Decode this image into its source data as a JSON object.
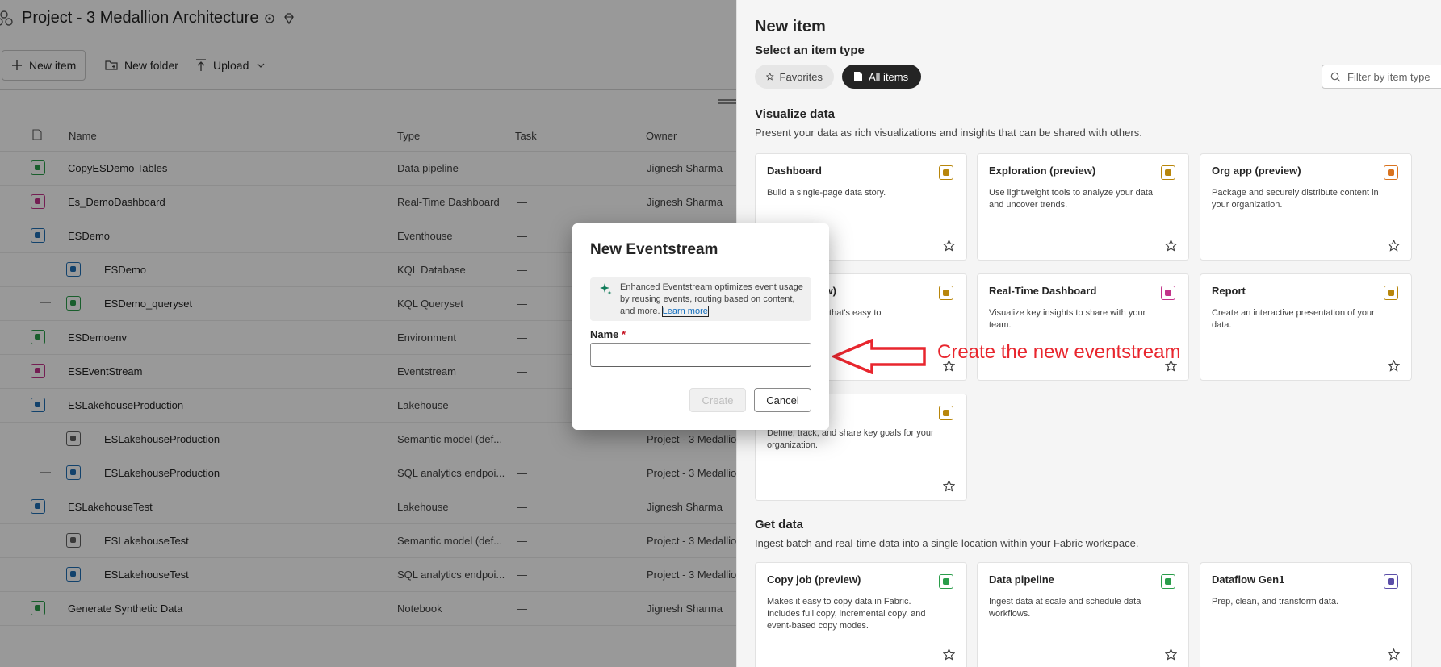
{
  "workspace": {
    "title": "Project - 3 Medallion Architecture",
    "toolbar": {
      "new_item": "New item",
      "new_folder": "New folder",
      "upload": "Upload"
    },
    "columns": {
      "name": "Name",
      "type": "Type",
      "task": "Task",
      "owner": "Owner"
    },
    "rows": [
      {
        "name": "CopyESDemo Tables",
        "type": "Data pipeline",
        "task": "—",
        "owner": "Jignesh Sharma",
        "icon": "data-pipeline-icon",
        "color": "#2a9d4a"
      },
      {
        "name": "Es_DemoDashboard",
        "type": "Real-Time Dashboard",
        "task": "—",
        "owner": "Jignesh Sharma",
        "icon": "dashboard-icon",
        "color": "#c2338a"
      },
      {
        "name": "ESDemo",
        "type": "Eventhouse",
        "task": "—",
        "owner": "",
        "icon": "eventhouse-icon",
        "color": "#1f6fb5"
      },
      {
        "name": "ESDemo",
        "type": "KQL Database",
        "task": "—",
        "owner": "",
        "icon": "kql-database-icon",
        "color": "#1f6fb5"
      },
      {
        "name": "ESDemo_queryset",
        "type": "KQL Queryset",
        "task": "—",
        "owner": "",
        "icon": "kql-queryset-icon",
        "color": "#2a9d4a"
      },
      {
        "name": "ESDemoenv",
        "type": "Environment",
        "task": "—",
        "owner": "",
        "icon": "environment-icon",
        "color": "#2a9d4a"
      },
      {
        "name": "ESEventStream",
        "type": "Eventstream",
        "task": "—",
        "owner": "",
        "icon": "eventstream-icon",
        "color": "#c2338a"
      },
      {
        "name": "ESLakehouseProduction",
        "type": "Lakehouse",
        "task": "—",
        "owner": "",
        "icon": "lakehouse-icon",
        "color": "#1f6fb5"
      },
      {
        "name": "ESLakehouseProduction",
        "type": "Semantic model (def...",
        "task": "—",
        "owner": "Project - 3 Medallio",
        "icon": "semantic-model-icon",
        "color": "#616161"
      },
      {
        "name": "ESLakehouseProduction",
        "type": "SQL analytics endpoi...",
        "task": "—",
        "owner": "Project - 3 Medallio",
        "icon": "sql-endpoint-icon",
        "color": "#1f6fb5"
      },
      {
        "name": "ESLakehouseTest",
        "type": "Lakehouse",
        "task": "—",
        "owner": "Jignesh Sharma",
        "icon": "lakehouse-icon",
        "color": "#1f6fb5"
      },
      {
        "name": "ESLakehouseTest",
        "type": "Semantic model (def...",
        "task": "—",
        "owner": "Project - 3 Medallio",
        "icon": "semantic-model-icon",
        "color": "#616161"
      },
      {
        "name": "ESLakehouseTest",
        "type": "SQL analytics endpoi...",
        "task": "—",
        "owner": "Project - 3 Medallio",
        "icon": "sql-endpoint-icon",
        "color": "#1f6fb5"
      },
      {
        "name": "Generate Synthetic Data",
        "type": "Notebook",
        "task": "—",
        "owner": "Jignesh Sharma",
        "icon": "notebook-icon",
        "color": "#2a9d4a"
      }
    ]
  },
  "panel": {
    "title": "New item",
    "subtitle": "Select an item type",
    "tabs": {
      "favorites": "Favorites",
      "all_items": "All items"
    },
    "filter_placeholder": "Filter by item type",
    "visualize": {
      "title": "Visualize data",
      "desc": "Present your data as rich visualizations and insights that can be shared with others.",
      "cards": [
        {
          "title": "Dashboard",
          "desc": "Build a single-page data story.",
          "icon": "dashboard-icon",
          "color": "#b8860b"
        },
        {
          "title": "Exploration (preview)",
          "desc": "Use lightweight tools to analyze your data and uncover trends.",
          "icon": "exploration-icon",
          "color": "#b8860b"
        },
        {
          "title": "Org app (preview)",
          "desc": "Package and securely distribute content in your organization.",
          "icon": "org-app-icon",
          "color": "#d9731f"
        },
        {
          "title": "port (preview)",
          "desc": "data in a report that's easy to",
          "icon": "paginated-report-icon",
          "color": "#b8860b"
        },
        {
          "title": "Real-Time Dashboard",
          "desc": "Visualize key insights to share with your team.",
          "icon": "realtime-dashboard-icon",
          "color": "#c2338a"
        },
        {
          "title": "Report",
          "desc": "Create an interactive presentation of your data.",
          "icon": "report-icon",
          "color": "#b8860b"
        },
        {
          "title": "",
          "desc": "Define, track, and share key goals for your organization.",
          "icon": "trophy-icon",
          "color": "#b8860b"
        }
      ]
    },
    "getdata": {
      "title": "Get data",
      "desc": "Ingest batch and real-time data into a single location within your Fabric workspace.",
      "cards": [
        {
          "title": "Copy job (preview)",
          "desc": "Makes it easy to copy data in Fabric. Includes full copy, incremental copy, and event-based copy modes.",
          "icon": "copy-job-icon",
          "color": "#2a9d4a"
        },
        {
          "title": "Data pipeline",
          "desc": "Ingest data at scale and schedule data workflows.",
          "icon": "data-pipeline-icon",
          "color": "#2a9d4a"
        },
        {
          "title": "Dataflow Gen1",
          "desc": "Prep, clean, and transform data.",
          "icon": "dataflow-icon",
          "color": "#5b4ea8"
        }
      ]
    }
  },
  "dialog": {
    "title": "New Eventstream",
    "info_text": "Enhanced Eventstream optimizes event usage by reusing events, routing based on content, and more.",
    "info_link": "Learn more",
    "name_label": "Name",
    "required_mark": "*",
    "name_value": "",
    "create_label": "Create",
    "cancel_label": "Cancel"
  },
  "annotation": {
    "text": "Create the new eventstream",
    "color": "#e8262e"
  }
}
